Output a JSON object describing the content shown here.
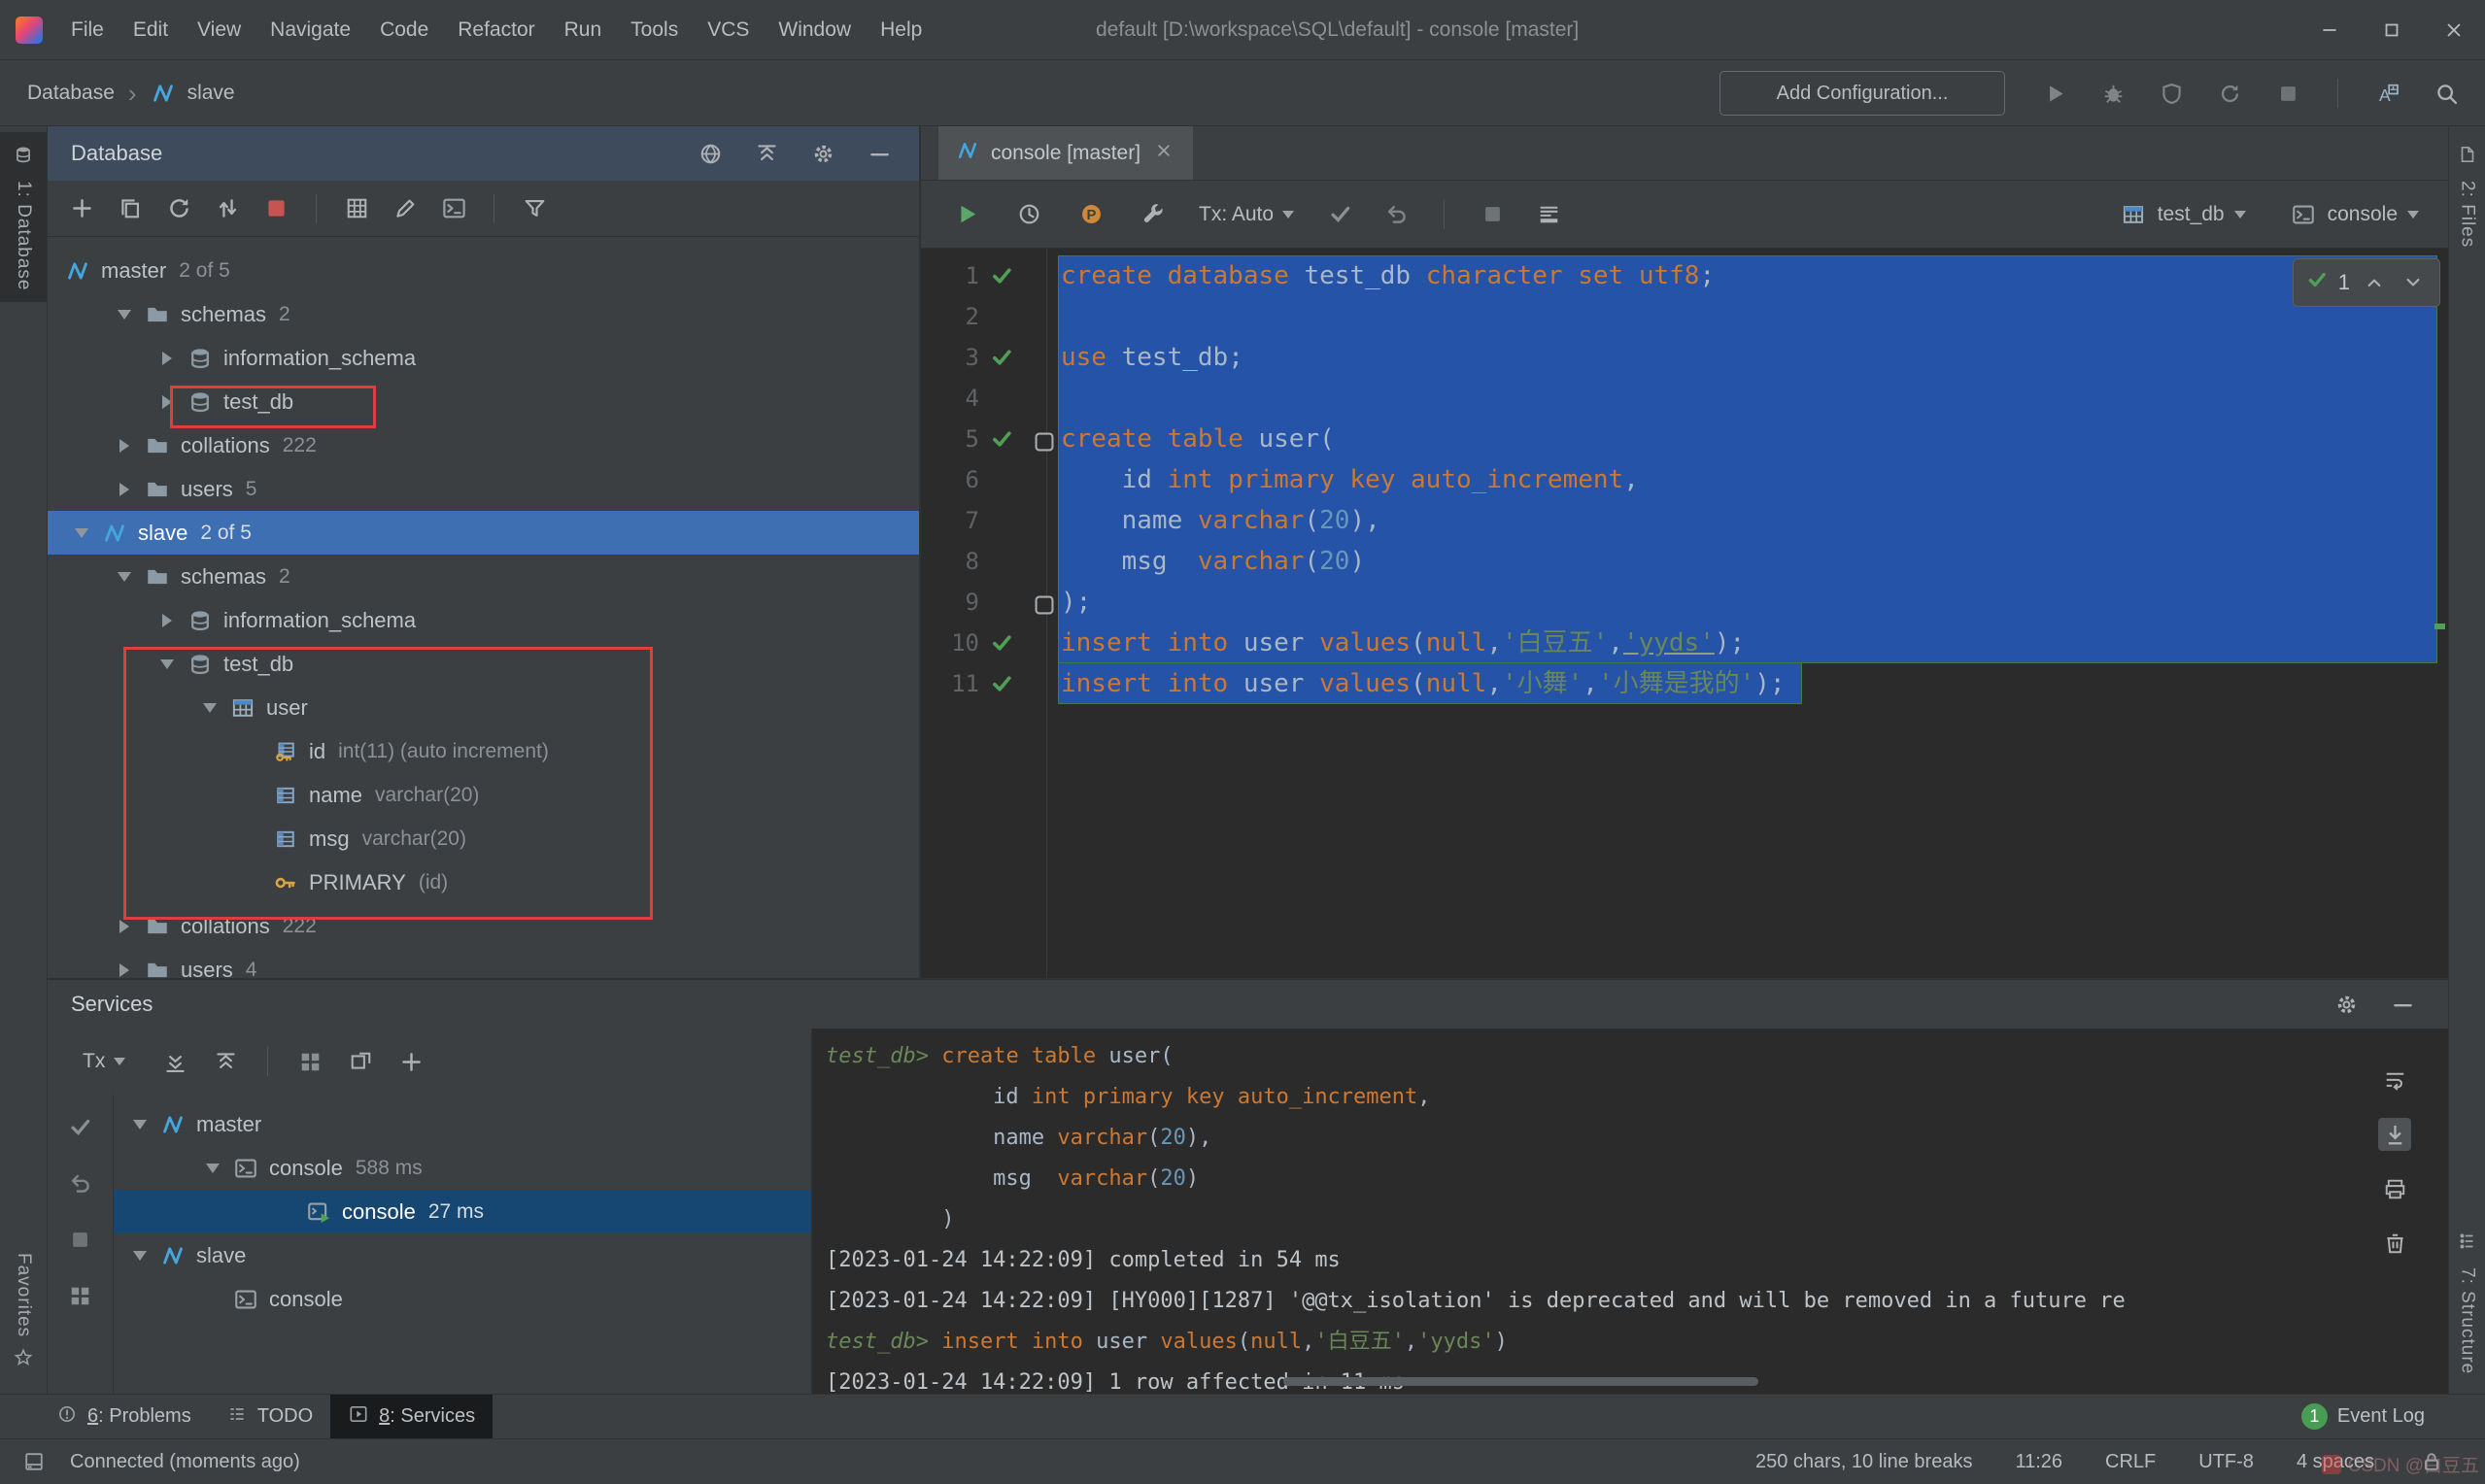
{
  "window": {
    "title": "default [D:\\workspace\\SQL\\default] - console [master]",
    "menu": [
      "File",
      "Edit",
      "View",
      "Navigate",
      "Code",
      "Refactor",
      "Run",
      "Tools",
      "VCS",
      "Window",
      "Help"
    ],
    "controls": [
      "win-min",
      "win-max",
      "win-close"
    ]
  },
  "run_toolbar": {
    "breadcrumb": [
      "Database",
      "slave"
    ],
    "add_config_label": "Add Configuration...",
    "right_icons": [
      "run-disabled",
      "debug",
      "coverage",
      "restart",
      "stop-gray",
      "sep",
      "translate",
      "search"
    ]
  },
  "left_strip": {
    "top_label": "1: Database",
    "bottom_label": "Favorites"
  },
  "right_strip": {
    "top_label": "2: Files",
    "bottom_label": "7: Structure"
  },
  "database_panel": {
    "title": "Database",
    "header_icons": [
      "globe",
      "collapse-all",
      "gear",
      "minimize"
    ],
    "toolbar_icons": [
      "add",
      "copy",
      "refresh",
      "sync",
      "stop-red",
      "sep",
      "grid",
      "edit",
      "console",
      "sep",
      "filter"
    ],
    "tree": [
      {
        "level": 0,
        "chevron": "none",
        "icon": "datasource",
        "label": "master",
        "meta": "2 of 5"
      },
      {
        "level": 1,
        "chevron": "down",
        "icon": "folder",
        "label": "schemas",
        "meta": "2"
      },
      {
        "level": 2,
        "chevron": "right",
        "icon": "schema",
        "label": "information_schema"
      },
      {
        "level": 2,
        "chevron": "right",
        "icon": "schema",
        "label": "test_db"
      },
      {
        "level": 1,
        "chevron": "right",
        "icon": "folder",
        "label": "collations",
        "meta": "222"
      },
      {
        "level": 1,
        "chevron": "right",
        "icon": "folder",
        "label": "users",
        "meta": "5"
      },
      {
        "level": 0,
        "chevron": "down",
        "icon": "datasource",
        "label": "slave",
        "meta": "2 of 5",
        "selected": true
      },
      {
        "level": 1,
        "chevron": "down",
        "icon": "folder",
        "label": "schemas",
        "meta": "2"
      },
      {
        "level": 2,
        "chevron": "right",
        "icon": "schema",
        "label": "information_schema"
      },
      {
        "level": 2,
        "chevron": "down",
        "icon": "schema",
        "label": "test_db"
      },
      {
        "level": 3,
        "chevron": "down",
        "icon": "table",
        "label": "user"
      },
      {
        "level": 4,
        "chevron": "blank",
        "icon": "column-key",
        "label": "id",
        "meta": "int(11) (auto increment)"
      },
      {
        "level": 4,
        "chevron": "blank",
        "icon": "column",
        "label": "name",
        "meta": "varchar(20)"
      },
      {
        "level": 4,
        "chevron": "blank",
        "icon": "column",
        "label": "msg",
        "meta": "varchar(20)"
      },
      {
        "level": 4,
        "chevron": "blank",
        "icon": "key",
        "label": "PRIMARY",
        "meta": "(id)"
      },
      {
        "level": 1,
        "chevron": "right",
        "icon": "folder",
        "label": "collations",
        "meta": "222"
      },
      {
        "level": 1,
        "chevron": "right",
        "icon": "folder",
        "label": "users",
        "meta": "4"
      }
    ]
  },
  "editor": {
    "tab_label": "console [master]",
    "tx_label": "Tx: Auto",
    "left_icons": [
      "run-green",
      "history",
      "parameters",
      "wrench"
    ],
    "mid_icons": [
      "commit-check",
      "rollback",
      "sep",
      "stop-gray",
      "output"
    ],
    "db_selector": "test_db",
    "console_selector": "console",
    "search_count": "1",
    "lines": [
      {
        "n": 1,
        "check": true,
        "tokens": [
          [
            "kw",
            "create database"
          ],
          [
            "pl",
            " test_db "
          ],
          [
            "kw",
            "character set utf8"
          ],
          [
            "pl",
            ";"
          ]
        ]
      },
      {
        "n": 2,
        "check": false,
        "tokens": []
      },
      {
        "n": 3,
        "check": true,
        "tokens": [
          [
            "kw",
            "use"
          ],
          [
            "pl",
            " test_db;"
          ]
        ]
      },
      {
        "n": 4,
        "check": false,
        "tokens": []
      },
      {
        "n": 5,
        "check": true,
        "marker": true,
        "tokens": [
          [
            "kw",
            "create table"
          ],
          [
            "pl",
            " user("
          ]
        ]
      },
      {
        "n": 6,
        "check": false,
        "tokens": [
          [
            "pl",
            "    id "
          ],
          [
            "kw",
            "int primary key auto_increment"
          ],
          [
            "pl",
            ","
          ]
        ]
      },
      {
        "n": 7,
        "check": false,
        "tokens": [
          [
            "pl",
            "    name "
          ],
          [
            "kw",
            "varchar"
          ],
          [
            "pl",
            "("
          ],
          [
            "num",
            "20"
          ],
          [
            "pl",
            "),"
          ]
        ]
      },
      {
        "n": 8,
        "check": false,
        "tokens": [
          [
            "pl",
            "    msg  "
          ],
          [
            "kw",
            "varchar"
          ],
          [
            "pl",
            "("
          ],
          [
            "num",
            "20"
          ],
          [
            "pl",
            ")"
          ]
        ]
      },
      {
        "n": 9,
        "check": false,
        "marker": true,
        "tokens": [
          [
            "pl",
            ");"
          ]
        ]
      },
      {
        "n": 10,
        "check": true,
        "tokens": [
          [
            "kw",
            "insert into"
          ],
          [
            "pl",
            " user "
          ],
          [
            "kw",
            "values"
          ],
          [
            "pl",
            "("
          ],
          [
            "kw",
            "null"
          ],
          [
            "pl",
            ","
          ],
          [
            "str",
            "'白豆五'"
          ],
          [
            "pl",
            ","
          ],
          [
            "str-u",
            "'yyds'"
          ],
          [
            "pl",
            ");"
          ]
        ]
      },
      {
        "n": 11,
        "check": true,
        "tokens": [
          [
            "kw",
            "insert into"
          ],
          [
            "pl",
            " user "
          ],
          [
            "kw",
            "values"
          ],
          [
            "pl",
            "("
          ],
          [
            "kw",
            "null"
          ],
          [
            "pl",
            ","
          ],
          [
            "str",
            "'小舞'"
          ],
          [
            "pl",
            ","
          ],
          [
            "str",
            "'小舞是我的'"
          ],
          [
            "pl",
            ");"
          ]
        ]
      }
    ]
  },
  "services_panel": {
    "title": "Services",
    "tx_label": "Tx",
    "header_icons": [
      "gear",
      "minimize"
    ],
    "toolbar_icons": [
      "expand-all",
      "collapse-all",
      "sep",
      "squares",
      "float-mode",
      "add"
    ],
    "left_icons": [
      "commit-check",
      "rollback",
      "stop-gray",
      "squares"
    ],
    "console_icons": [
      "soft-wrap",
      "scroll-end",
      "print",
      "clear"
    ],
    "tree": [
      {
        "level": 0,
        "chevron": "down",
        "icon": "datasource",
        "label": "master"
      },
      {
        "level": 1,
        "chevron": "down",
        "icon": "console",
        "label": "console",
        "meta": "588 ms"
      },
      {
        "level": 2,
        "chevron": "blank",
        "icon": "console-run",
        "label": "console",
        "meta": "27 ms",
        "selected": true
      },
      {
        "level": 0,
        "chevron": "down",
        "icon": "datasource",
        "label": "slave"
      },
      {
        "level": 1,
        "chevron": "blank",
        "icon": "console",
        "label": "console"
      }
    ],
    "console": [
      [
        [
          "prompt",
          "test_db> "
        ],
        [
          "kw",
          "create table"
        ],
        [
          "pl",
          " user("
        ]
      ],
      [
        [
          "pl",
          "             id "
        ],
        [
          "kw",
          "int primary key auto_increment"
        ],
        [
          "pl",
          ","
        ]
      ],
      [
        [
          "pl",
          "             name "
        ],
        [
          "kw",
          "varchar"
        ],
        [
          "pl",
          "("
        ],
        [
          "num",
          "20"
        ],
        [
          "pl",
          "),"
        ]
      ],
      [
        [
          "pl",
          "             msg  "
        ],
        [
          "kw",
          "varchar"
        ],
        [
          "pl",
          "("
        ],
        [
          "num",
          "20"
        ],
        [
          "pl",
          ")"
        ]
      ],
      [
        [
          "pl",
          "         )"
        ]
      ],
      [
        [
          "log",
          "[2023-01-24 14:22:09] completed in 54 ms"
        ]
      ],
      [
        [
          "log",
          "[2023-01-24 14:22:09] [HY000][1287] '@@tx_isolation' is deprecated and will be removed in a future re"
        ]
      ],
      [
        [
          "prompt",
          "test_db> "
        ],
        [
          "kw",
          "insert into"
        ],
        [
          "pl",
          " user "
        ],
        [
          "kw",
          "values"
        ],
        [
          "pl",
          "("
        ],
        [
          "kw",
          "null"
        ],
        [
          "pl",
          ","
        ],
        [
          "str",
          "'白豆五'"
        ],
        [
          "pl",
          ","
        ],
        [
          "str",
          "'yyds'"
        ],
        [
          "pl",
          ")"
        ]
      ],
      [
        [
          "log",
          "[2023-01-24 14:22:09] 1 row affected in 11 ms"
        ]
      ]
    ]
  },
  "bottom_bar": {
    "problems_mnemonic": "6",
    "problems_rest": ": Problems",
    "todo": "TODO",
    "services_mnemonic": "8",
    "services_rest": ": Services",
    "event_count": "1",
    "event_log": "Event Log"
  },
  "status_bar": {
    "left": "Connected (moments ago)",
    "chars": "250 chars, 10 line breaks",
    "position": "11:26",
    "line_ending": "CRLF",
    "encoding": "UTF-8",
    "indent": "4 spaces",
    "watermark": "CSDN @白豆五"
  },
  "colors": {
    "panel_bg": "#3c3f41",
    "editor_bg": "#2b2b2b",
    "keyword": "#cc7832",
    "string": "#6a8759",
    "number": "#6897bb",
    "plain_code": "#a9b7c6",
    "editor_selection": "#2453a8",
    "tree_selection": "#3e6fb3",
    "services_selection": "#164672",
    "check_green": "#4f9f57",
    "stop_red": "#c75450",
    "annotation_red": "#e03e3e",
    "tool_header": "#3d4b5c"
  }
}
